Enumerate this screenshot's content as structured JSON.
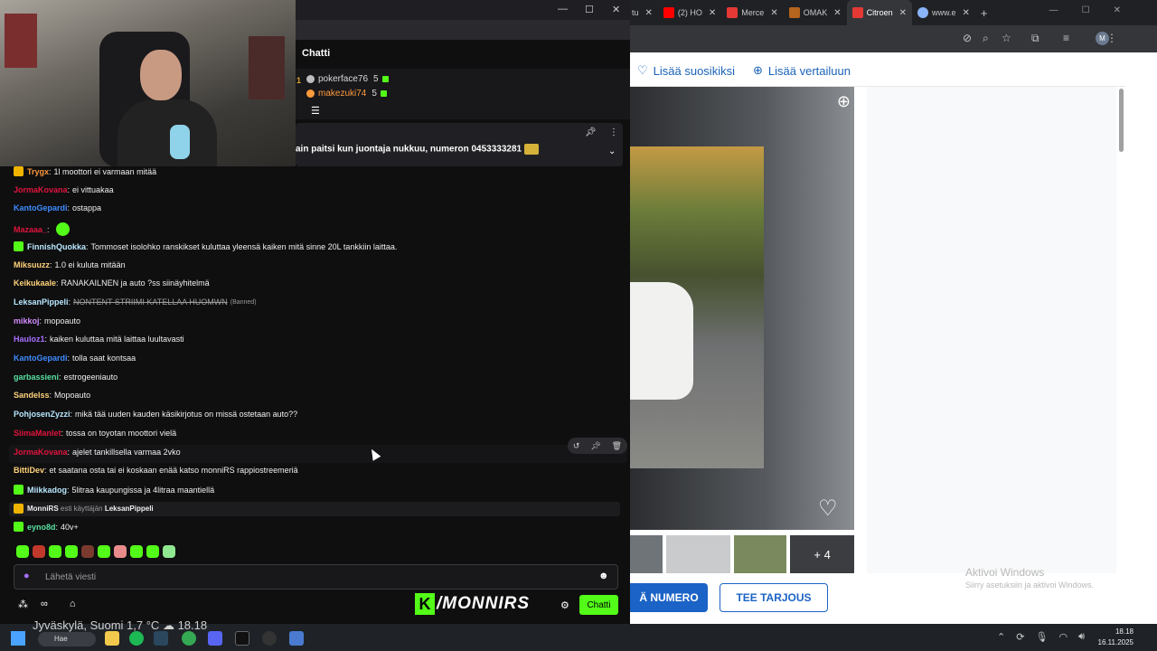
{
  "browser": {
    "tabs": [
      {
        "label": "(2) HO",
        "icon_color": "#ff0000"
      },
      {
        "label": "Merce",
        "icon_color": "#e53935"
      },
      {
        "label": "OMAK",
        "icon_color": "#b5651d"
      },
      {
        "label": "Citroen",
        "icon_color": "#e53935",
        "active": true
      },
      {
        "label": "www.e",
        "icon_color": "#8ab4f8"
      }
    ],
    "page_links": {
      "favorite": "Lisää suosikiksi",
      "compare": "Lisää vertailuun"
    },
    "thumbs_more": "+ 4",
    "buttons": {
      "number": "Ä NUMERO",
      "offer": "TEE TARJOUS"
    },
    "activate_title": "Aktivoi Windows",
    "activate_sub": "Siirry asetuksiin ja aktivoi Windows.",
    "profile_initial": "M",
    "accent_color": "#1b63c6"
  },
  "chat": {
    "title": "Chatti",
    "leaderboard": [
      {
        "rank": "1",
        "name": "pokerface76",
        "points": "5",
        "color": "#d9d9d9"
      },
      {
        "name": "makezuki74",
        "points": "5",
        "color": "#ff9a3c"
      }
    ],
    "pinned_message": "ain paitsi kun juontaja nukkuu, numeron 0453333281",
    "messages": [
      {
        "user": "Trygx",
        "text": "1l moottori ei varmaan mitää",
        "color": "#ff9a3c",
        "badge": "#f0b400"
      },
      {
        "user": "JormaKovana",
        "text": "ei vittuakaa",
        "color": "#e0143c"
      },
      {
        "user": "KantoGepardi",
        "text": "ostappa",
        "color": "#3f8cff"
      },
      {
        "user": "Mazaaa_",
        "text": "",
        "color": "#e0143c",
        "emote": true
      },
      {
        "user": "FinnishQuokka",
        "text": "Tommoset isolohko ranskikset kuluttaa yleensä kaiken mitä sinne 20L tankkiin laittaa.",
        "color": "#b9e8ff",
        "badge": "#53fc18"
      },
      {
        "user": "Miksuuzz",
        "text": "1.0 ei kuluta mitään",
        "color": "#ffd27a"
      },
      {
        "user": "Keikukaale",
        "text": "RANAKAILNEN ja auto ?ss siinäyhitelmä",
        "color": "#ffd27a"
      },
      {
        "user": "LeksanPippeli",
        "text": "NONTENT STRIIMI KATELLAA HUOMWN",
        "color": "#b9e8ff",
        "strike": true,
        "banned": "(Banned)"
      },
      {
        "user": "mikkoj",
        "text": "mopoauto",
        "color": "#d38cff"
      },
      {
        "user": "Hauloz1",
        "text": "kaiken kuluttaa mitä laittaa luultavasti",
        "color": "#a970ff"
      },
      {
        "user": "KantoGepardi",
        "text": "tolla saat kontsaa",
        "color": "#3f8cff"
      },
      {
        "user": "garbassieni",
        "text": "estrogeeniauto",
        "color": "#58e0a0"
      },
      {
        "user": "Sandelss",
        "text": "Mopoauto",
        "color": "#ffd27a"
      },
      {
        "user": "PohjosenZyzzi",
        "text": "mikä tää uuden kauden käsikirjotus on missä ostetaan auto??",
        "color": "#b9e8ff"
      },
      {
        "user": "SiimaManlet",
        "text": "tossa on toyotan moottori vielä",
        "color": "#e0143c"
      },
      {
        "user": "JormaKovana",
        "text": "ajelet tankillsella varmaa 2vko",
        "color": "#e0143c"
      },
      {
        "user": "BittiDev",
        "text": "et saatana osta tai ei koskaan enää katso monniRS rappiostreemeriä",
        "color": "#ffd27a"
      },
      {
        "user": "Miikkadog",
        "text": "5litraa kaupungissa ja 4litraa maantiellä",
        "color": "#b9e8ff",
        "badge": "#53fc18"
      },
      {
        "user": "MonniRS",
        "text": "esti käyttäjän",
        "target": "LeksanPippeli",
        "color": "#efeff1",
        "mod": true,
        "badge": "#f0b400"
      },
      {
        "user": "eyno8d",
        "text": "40v+",
        "color": "#58e0a0",
        "badge": "#53fc18"
      }
    ],
    "input_placeholder": "Lähetä viesti",
    "channel_name": "/MONNIRS",
    "chat_button": "Chatti",
    "brand_color": "#53fc18"
  },
  "taskbar": {
    "weather": "Jyväskylä, Suomi   1,7 °C",
    "weather_time": "18.18",
    "search": "Hae",
    "clock_time": "18.18",
    "clock_date": "16.11.2025"
  }
}
